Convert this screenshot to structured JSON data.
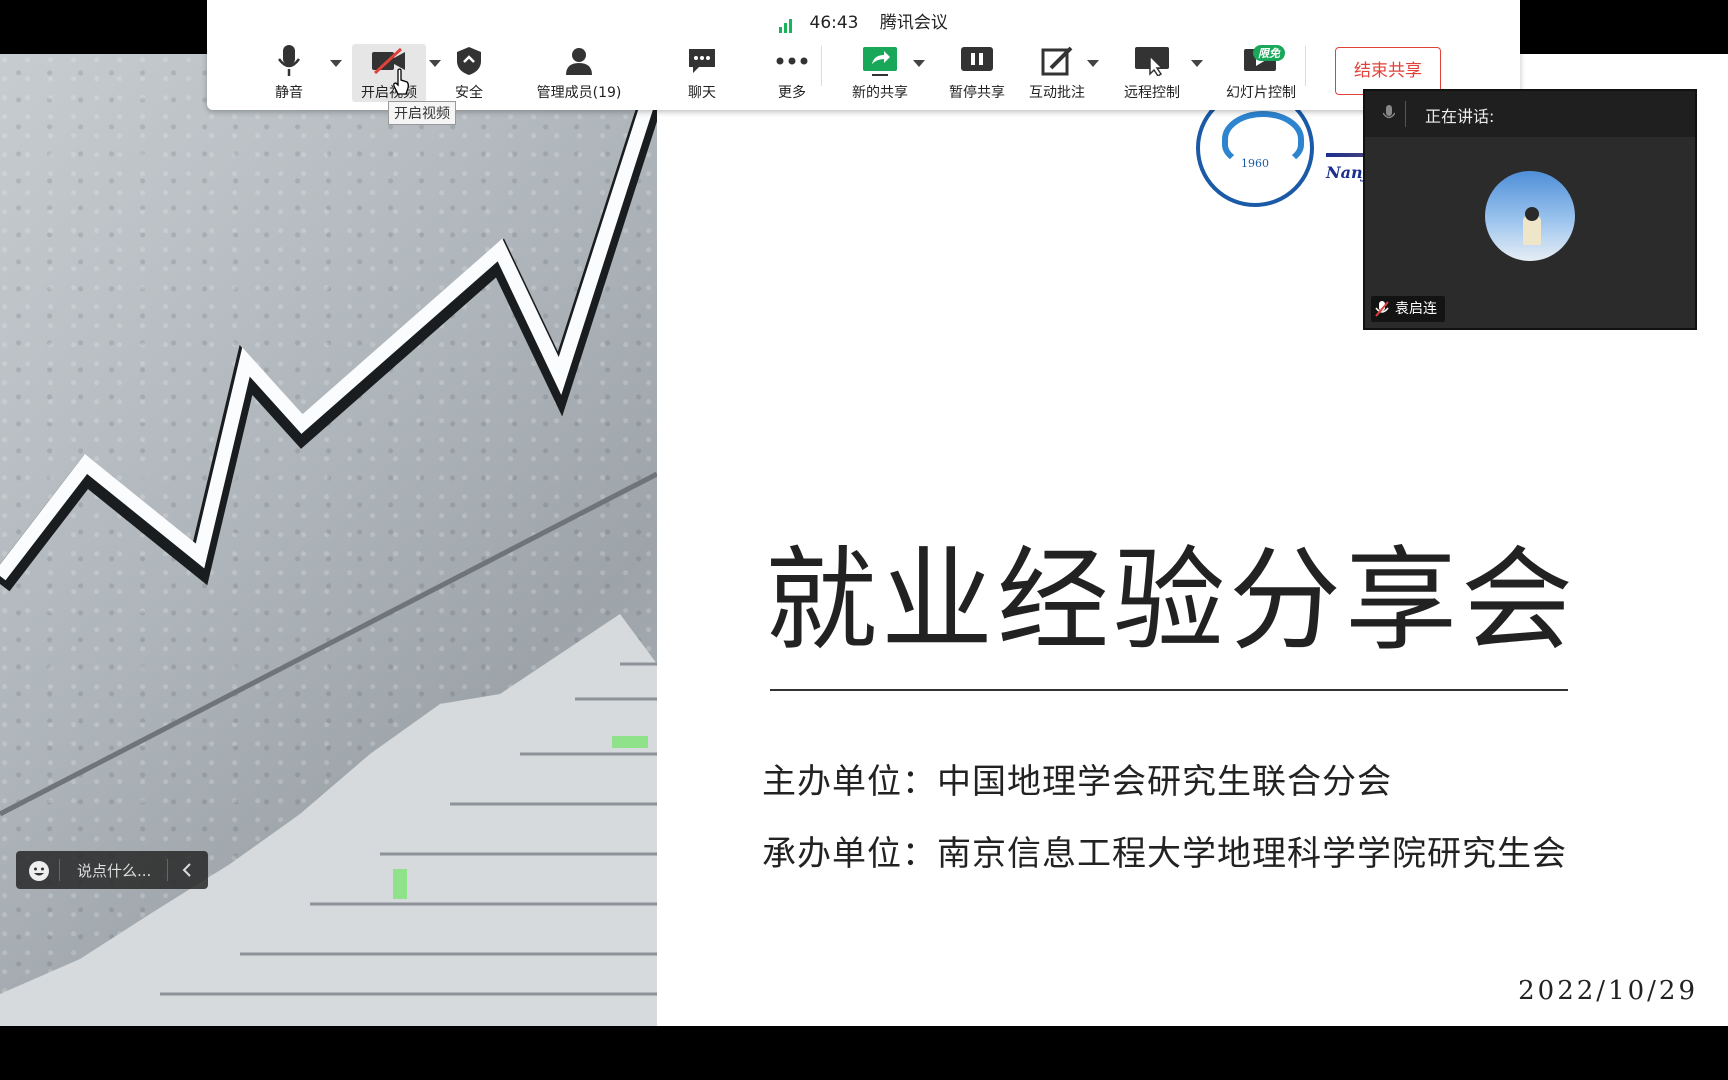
{
  "status": {
    "timer": "46:43",
    "app_name": "腾讯会议"
  },
  "toolbar": {
    "mute": "静音",
    "start_video": "开启视频",
    "security": "安全",
    "participants": "管理成员(19)",
    "chat": "聊天",
    "more": "更多",
    "new_share": "新的共享",
    "pause_share": "暂停共享",
    "annotate": "互动批注",
    "remote_control": "远程控制",
    "slide_control": "幻灯片控制",
    "free_badge": "限免",
    "end_share": "结束共享"
  },
  "tooltip": "开启视频",
  "speaker_panel": {
    "speaking_label": "正在讲话:",
    "name": "袁启连"
  },
  "chat_input": {
    "placeholder": "说点什么..."
  },
  "slide": {
    "title": "就业经验分享会",
    "host": "主办单位：中国地理学会研究生联合分会",
    "organizer": "承办单位：南京信息工程大学地理科学学院研究生会",
    "date": "2022/10/29",
    "logo_year": "1960",
    "logo_text_fragment": "Nanj"
  },
  "colors": {
    "accent_red": "#e0423a",
    "signal_green": "#19b35a",
    "logo_blue": "#1b5aa7"
  }
}
